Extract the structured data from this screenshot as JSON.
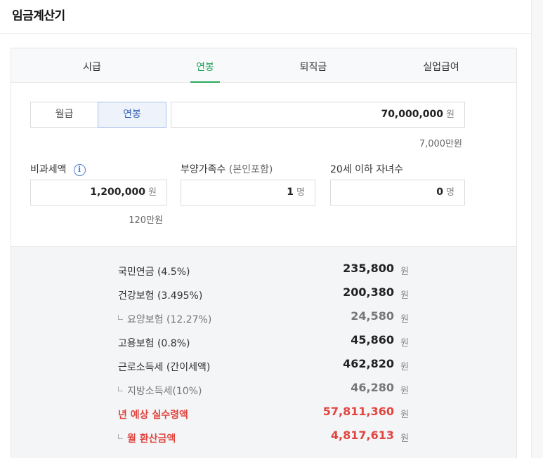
{
  "header": {
    "title": "임금계산기"
  },
  "tabs": [
    {
      "label": "시급",
      "active": false
    },
    {
      "label": "연봉",
      "active": true
    },
    {
      "label": "퇴직금",
      "active": false
    },
    {
      "label": "실업급여",
      "active": false
    }
  ],
  "salary": {
    "mode_monthly": "월급",
    "mode_annual": "연봉",
    "selected_mode": "연봉",
    "value": "70,000,000",
    "unit": "원",
    "note": "7,000만원"
  },
  "nontax": {
    "label": "비과세액",
    "info_icon": "info-icon",
    "value": "1,200,000",
    "unit": "원",
    "note": "120만원"
  },
  "family": {
    "label": "부양가족수",
    "label_sub": "(본인포함)",
    "value": "1",
    "unit": "명"
  },
  "children": {
    "label": "20세 이하 자녀수",
    "value": "0",
    "unit": "명"
  },
  "results": [
    {
      "label": "국민연금 (4.5%)",
      "value": "235,800",
      "unit": "원",
      "style": "normal"
    },
    {
      "label": "건강보험 (3.495%)",
      "value": "200,380",
      "unit": "원",
      "style": "normal"
    },
    {
      "label": "요양보험 (12.27%)",
      "value": "24,580",
      "unit": "원",
      "style": "sub"
    },
    {
      "label": "고용보험 (0.8%)",
      "value": "45,860",
      "unit": "원",
      "style": "normal"
    },
    {
      "label": "근로소득세 (간이세액)",
      "value": "462,820",
      "unit": "원",
      "style": "normal"
    },
    {
      "label": "지방소득세(10%)",
      "value": "46,280",
      "unit": "원",
      "style": "sub"
    },
    {
      "label": "년 예상 실수령액",
      "value": "57,811,360",
      "unit": "원",
      "style": "red"
    },
    {
      "label": "월 환산금액",
      "value": "4,817,613",
      "unit": "원",
      "style": "red-sub"
    }
  ],
  "colors": {
    "accent_green": "#2aa85c",
    "accent_blue": "#3a64b5",
    "highlight_red": "#e0453f"
  }
}
